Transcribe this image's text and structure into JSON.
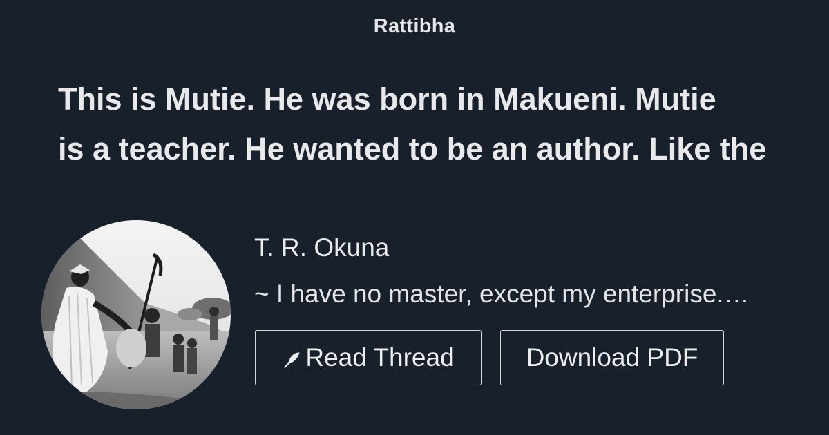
{
  "site": {
    "name": "Rattibha"
  },
  "thread": {
    "title_line1": "This is Mutie. He was born in Makueni. Mutie",
    "title_line2": "is a teacher. He wanted to be an author. Like the"
  },
  "author": {
    "name": "T. R. Okuna",
    "bio": "~ I have no master, except my enterprise.…"
  },
  "actions": {
    "read_label": "Read Thread",
    "pdf_label": "Download PDF",
    "read_icon": "feather-icon"
  },
  "colors": {
    "background": "#18202c",
    "text": "#e8e8ea",
    "button_border": "#d4d6da"
  }
}
